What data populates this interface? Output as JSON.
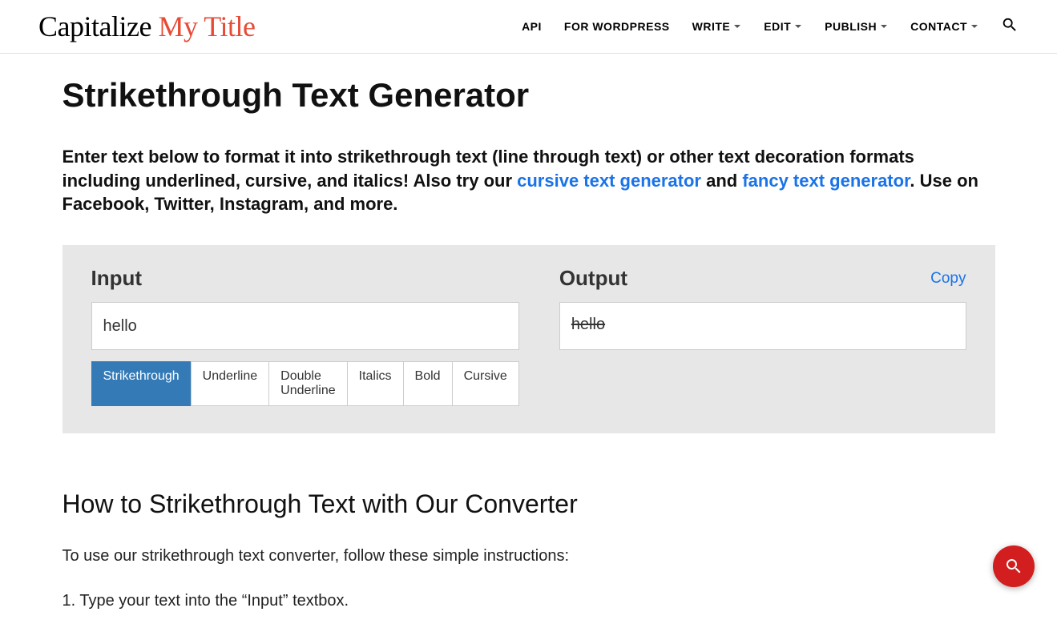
{
  "logo": {
    "part1": "Capitalize ",
    "part2": "My Title"
  },
  "nav": {
    "api": "API",
    "wordpress": "FOR WORDPRESS",
    "write": "WRITE",
    "edit": "EDIT",
    "publish": "PUBLISH",
    "contact": "CONTACT"
  },
  "page": {
    "title": "Strikethrough Text Generator",
    "intro_1": "Enter text below to format it into strikethrough text (line through text) or other text decoration formats including underlined, cursive, and italics! Also try our ",
    "intro_link1": "cursive text generator",
    "intro_2": " and ",
    "intro_link2": "fancy text generator",
    "intro_3": ". Use on Facebook, Twitter, Instagram, and more."
  },
  "tool": {
    "input_label": "Input",
    "output_label": "Output",
    "copy": "Copy",
    "input_value": "hello",
    "output_value": "hello ",
    "tabs": {
      "strikethrough": "Strikethrough",
      "underline": "Underline",
      "double_underline": "Double Underline",
      "italics": "Italics",
      "bold": "Bold",
      "cursive": "Cursive"
    }
  },
  "howto": {
    "title": "How to Strikethrough Text with Our Converter",
    "intro": "To use our strikethrough text converter, follow these simple instructions:",
    "step1": "1. Type your text into the “Input” textbox."
  }
}
